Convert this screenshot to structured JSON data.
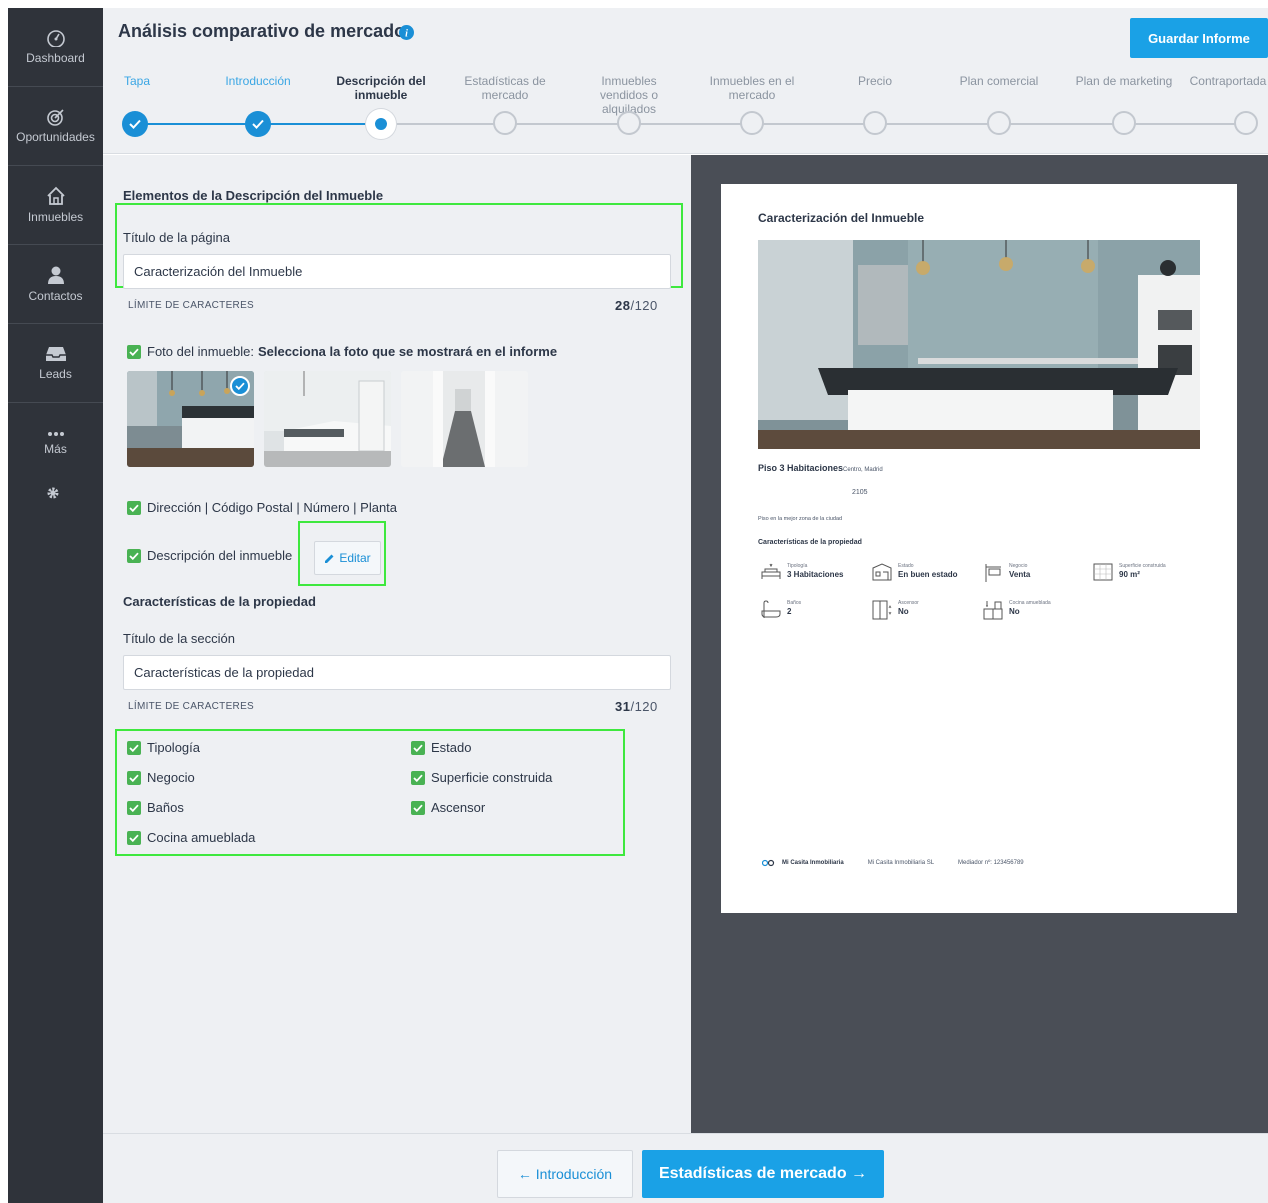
{
  "sidebar": {
    "items": [
      {
        "label": "Dashboard",
        "icon": "gauge-icon"
      },
      {
        "label": "Oportunidades",
        "icon": "target-icon"
      },
      {
        "label": "Inmuebles",
        "icon": "home-icon"
      },
      {
        "label": "Contactos",
        "icon": "user-icon"
      },
      {
        "label": "Leads",
        "icon": "inbox-icon"
      },
      {
        "label": "Más",
        "icon": "more-icon"
      }
    ],
    "settings_icon": "gear-icon"
  },
  "header": {
    "title": "Análisis comparativo de mercado",
    "save_label": "Guardar Informe",
    "steps": [
      {
        "label": "Tapa",
        "state": "done"
      },
      {
        "label": "Introducción",
        "state": "done"
      },
      {
        "label": "Descripción del inmueble",
        "state": "active"
      },
      {
        "label": "Estadísticas de mercado",
        "state": "todo"
      },
      {
        "label": "Inmuebles vendidos o alquilados",
        "state": "todo"
      },
      {
        "label": "Inmuebles en el mercado",
        "state": "todo"
      },
      {
        "label": "Precio",
        "state": "todo"
      },
      {
        "label": "Plan comercial",
        "state": "todo"
      },
      {
        "label": "Plan de marketing",
        "state": "todo"
      },
      {
        "label": "Contraportada",
        "state": "todo"
      }
    ]
  },
  "form": {
    "section_title": "Elementos de la Descripción del Inmueble",
    "page_title_label": "Título de la página",
    "page_title_value": "Caracterización del Inmueble",
    "char_limit_label": "LÍMITE DE CARACTERES",
    "page_title_count": "28",
    "char_max": "/120",
    "photo_label": "Foto del inmueble:",
    "photo_hint": "Selecciona la foto que se mostrará en el informe",
    "address_label": "Dirección | Código Postal | Número | Planta",
    "description_label": "Descripción del inmueble",
    "edit_label": "Editar",
    "features_title": "Características de la propiedad",
    "section_title_label": "Título de la sección",
    "section_title_value": "Características de la propiedad",
    "section_title_count": "31",
    "features": [
      {
        "label": "Tipología",
        "checked": true
      },
      {
        "label": "Estado",
        "checked": true
      },
      {
        "label": "Negocio",
        "checked": true
      },
      {
        "label": "Superficie construida",
        "checked": true
      },
      {
        "label": "Baños",
        "checked": true
      },
      {
        "label": "Ascensor",
        "checked": true
      },
      {
        "label": "Cocina amueblada",
        "checked": true
      }
    ]
  },
  "preview": {
    "title": "Caracterización del Inmueble",
    "property_name": "Piso 3 Habitaciones",
    "location": "Centro, Madrid",
    "number": "2105",
    "description": "Piso en la mejor zona de la ciudad",
    "features_title": "Características de la propiedad",
    "features": [
      {
        "key": "Tipología",
        "value": "3 Habitaciones"
      },
      {
        "key": "Estado",
        "value": "En buen estado"
      },
      {
        "key": "Negocio",
        "value": "Venta"
      },
      {
        "key": "Superficie construida",
        "value": "90 m²"
      },
      {
        "key": "Baños",
        "value": "2"
      },
      {
        "key": "Ascensor",
        "value": "No"
      },
      {
        "key": "Cocina amueblada",
        "value": "No"
      }
    ],
    "footer_brand": "Mi Casita Inmobiliaria",
    "footer_company": "Mi Casita Inmobiliaria SL",
    "footer_mediator": "Mediador nº: 123456789"
  },
  "footer": {
    "prev_label": "← Introducción",
    "next_label": "Estadísticas de mercado →"
  },
  "colors": {
    "accent": "#1aa1e6",
    "sidebar": "#2f333a",
    "check": "#49b253",
    "highlight": "#3ee83e"
  }
}
